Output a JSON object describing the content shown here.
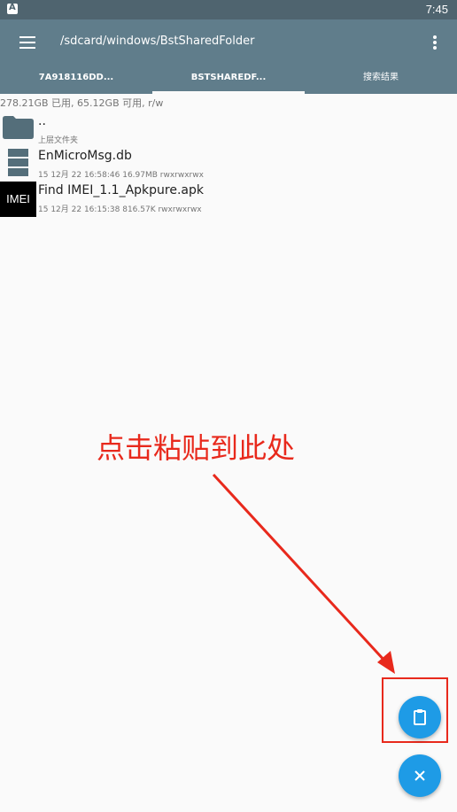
{
  "status_bar": {
    "time": "7:45",
    "app_icon": "a-icon"
  },
  "toolbar": {
    "path": "/sdcard/windows/BstSharedFolder",
    "menu_icon": "hamburger-menu-icon",
    "overflow_icon": "more-vert-icon"
  },
  "tabs": [
    {
      "label": "7A918116DD..."
    },
    {
      "label": "BSTSHAREDF...",
      "selected": true
    },
    {
      "label": "搜索结果"
    }
  ],
  "storage_info": "278.21GB 已用, 65.12GB 可用, r/w",
  "files": [
    {
      "name": "..",
      "meta": "上层文件夹",
      "icon": "folder-icon"
    },
    {
      "name": "EnMicroMsg.db",
      "meta": "15 12月 22 16:58:46  16.97MB  rwxrwxrwx",
      "icon": "database-icon"
    },
    {
      "name": "Find IMEI_1.1_Apkpure.apk",
      "meta": "15 12月 22 16:15:38  816.57K  rwxrwxrwx",
      "icon_text": "IMEI"
    }
  ],
  "annotation": {
    "text": "点击粘贴到此处",
    "color": "#e8291c"
  },
  "fabs": {
    "paste_icon": "clipboard-icon",
    "close_icon": "close-icon",
    "color": "#1e9be6"
  },
  "colors": {
    "toolbar": "#607d8b",
    "status_bar": "#4f646f"
  }
}
